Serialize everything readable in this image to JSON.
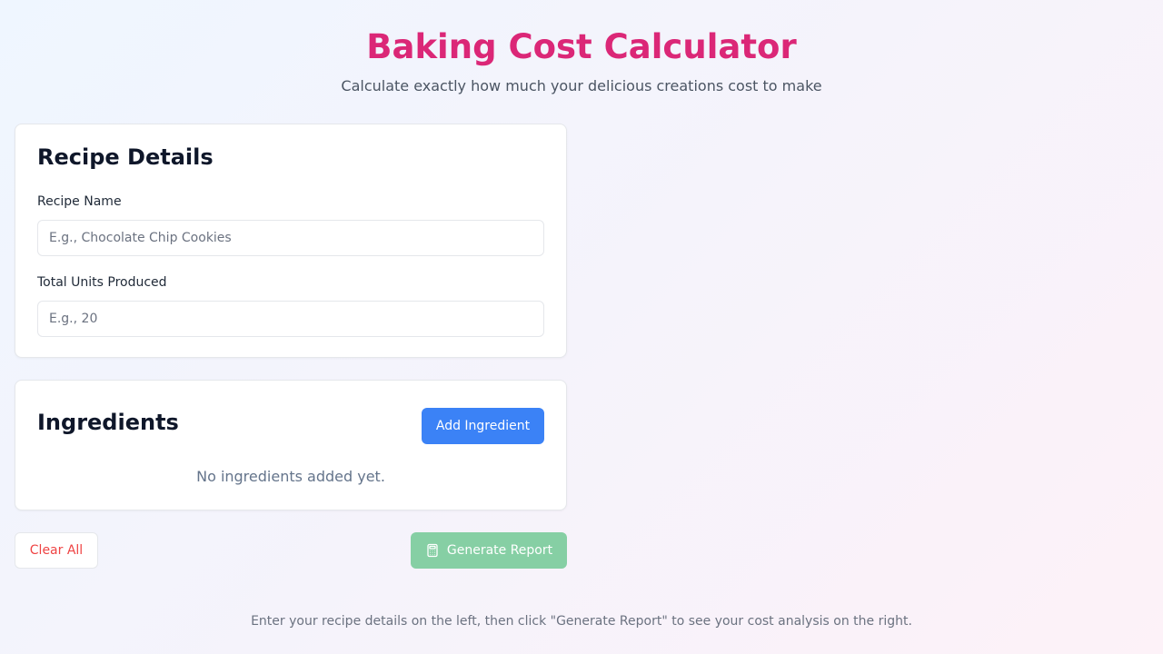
{
  "header": {
    "title": "Baking Cost Calculator",
    "subtitle": "Calculate exactly how much your delicious creations cost to make"
  },
  "recipe_details": {
    "title": "Recipe Details",
    "recipe_name": {
      "label": "Recipe Name",
      "value": "",
      "placeholder": "E.g., Chocolate Chip Cookies"
    },
    "total_units": {
      "label": "Total Units Produced",
      "value": "",
      "placeholder": "E.g., 20"
    }
  },
  "ingredients": {
    "title": "Ingredients",
    "add_button_label": "Add Ingredient",
    "empty_message": "No ingredients added yet.",
    "items": []
  },
  "actions": {
    "clear_label": "Clear All",
    "generate_label": "Generate Report",
    "generate_icon": "calculator-icon",
    "generate_disabled": true
  },
  "footer": {
    "hint": "Enter your recipe details on the left, then click \"Generate Report\" to see your cost analysis on the right."
  },
  "colors": {
    "title": "#db2777",
    "primary_button": "#3b82f6",
    "generate_button_disabled": "#86cfa4",
    "danger_text": "#ef4444"
  }
}
